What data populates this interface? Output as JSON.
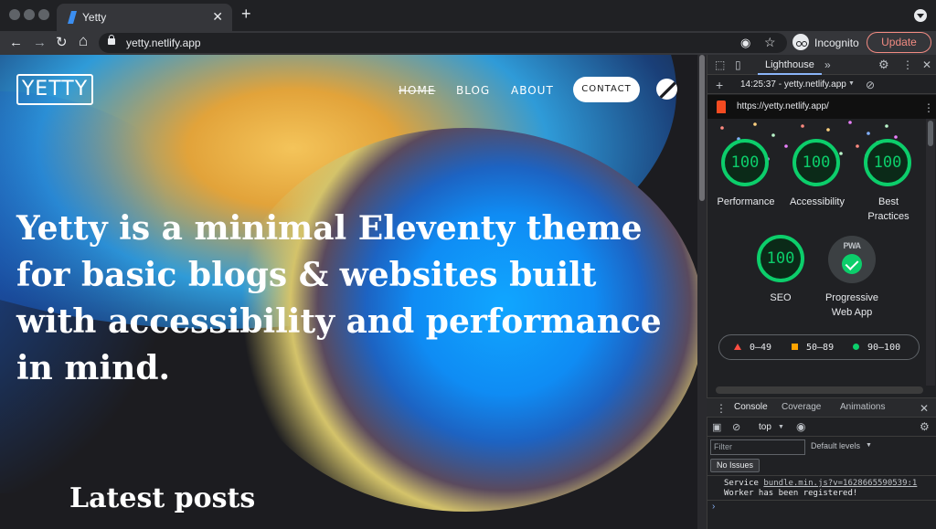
{
  "browser": {
    "tab_title": "Yetty",
    "tab_close": "✕",
    "new_tab": "+",
    "url": "yetty.netlify.app",
    "incognito_label": "Incognito",
    "update_label": "Update",
    "icons": {
      "back": "←",
      "forward": "→",
      "reload": "↻",
      "home": "⌂",
      "eye_off": "◉",
      "star": "☆",
      "kebab": "⋮"
    }
  },
  "site": {
    "logo": "YETTY",
    "nav": {
      "home": "HOME",
      "blog": "BLOG",
      "about": "ABOUT",
      "contact": "CONTACT"
    },
    "hero": "Yetty is a minimal Eleventy theme for basic blogs & websites built with accessibility and performance in mind.",
    "latest_posts": "Latest posts"
  },
  "devtools": {
    "panel_tab": "Lighthouse",
    "more_tabs": "»",
    "report_label": "14:25:37 - yetty.netlify.app",
    "report_url": "https://yetty.netlify.app/",
    "scores": [
      {
        "label": "Performance",
        "value": "100"
      },
      {
        "label": "Accessibility",
        "value": "100"
      },
      {
        "label": "Best Practices",
        "value": "100"
      },
      {
        "label": "SEO",
        "value": "100"
      }
    ],
    "pwa": {
      "badge": "PWA",
      "label": "Progressive Web App"
    },
    "legend": {
      "fail": "0–49",
      "average": "50–89",
      "pass": "90–100"
    },
    "colors": {
      "pass": "#0cce6b",
      "average": "#ffa400",
      "fail": "#ff4e42"
    },
    "drawer": {
      "tabs": [
        "Console",
        "Coverage",
        "Animations"
      ],
      "context": "top",
      "filter_placeholder": "Filter",
      "levels": "Default levels",
      "no_issues": "No Issues",
      "log_prefix": "Service ",
      "log_link": "bundle.min.js?v=1628665590539:1",
      "log_line2": "Worker has been registered!",
      "prompt": "›"
    }
  }
}
